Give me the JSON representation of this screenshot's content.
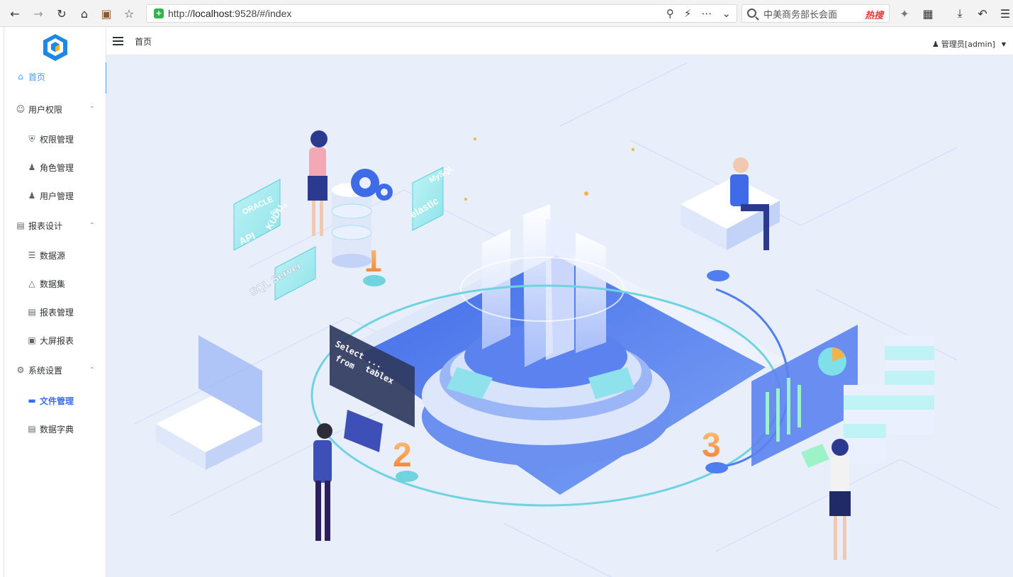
{
  "browser": {
    "url_prefix": "http://",
    "url_host": "localhost",
    "url_rest": ":9528/#/index",
    "search_query": "中美商务部长会面",
    "search_hot": "热搜"
  },
  "sidebar": {
    "items": [
      {
        "label": "首页",
        "icon": "home-icon"
      },
      {
        "label": "用户权限",
        "icon": "user-group-icon"
      },
      {
        "label": "权限管理",
        "icon": "shield-icon"
      },
      {
        "label": "角色管理",
        "icon": "role-icon"
      },
      {
        "label": "用户管理",
        "icon": "user-icon"
      },
      {
        "label": "报表设计",
        "icon": "report-design-icon"
      },
      {
        "label": "数据源",
        "icon": "database-icon"
      },
      {
        "label": "数据集",
        "icon": "dataset-icon"
      },
      {
        "label": "报表管理",
        "icon": "report-icon"
      },
      {
        "label": "大屏报表",
        "icon": "screen-icon"
      },
      {
        "label": "系统设置",
        "icon": "gear-icon"
      },
      {
        "label": "文件管理",
        "icon": "folder-icon"
      },
      {
        "label": "数据字典",
        "icon": "dictionary-icon"
      }
    ]
  },
  "header": {
    "breadcrumb": "首页",
    "user": "管理员[admin]"
  },
  "illustration": {
    "labels": {
      "oracle": "ORACLE",
      "api": "API",
      "apache": "APACHE",
      "kudu": "KUDU",
      "mysql": "MySQL",
      "elastic": "elastic",
      "sqlserver": "SQL Server",
      "select": "Select ...",
      "from": "from",
      "tablex": "tablex",
      "step1": "1",
      "step2": "2",
      "step3": "3"
    }
  },
  "colors": {
    "accent": "#409eff",
    "active_menu": "#3a6ee8",
    "main_bg": "#e9eefb",
    "platform_blue": "#5b82ee"
  }
}
